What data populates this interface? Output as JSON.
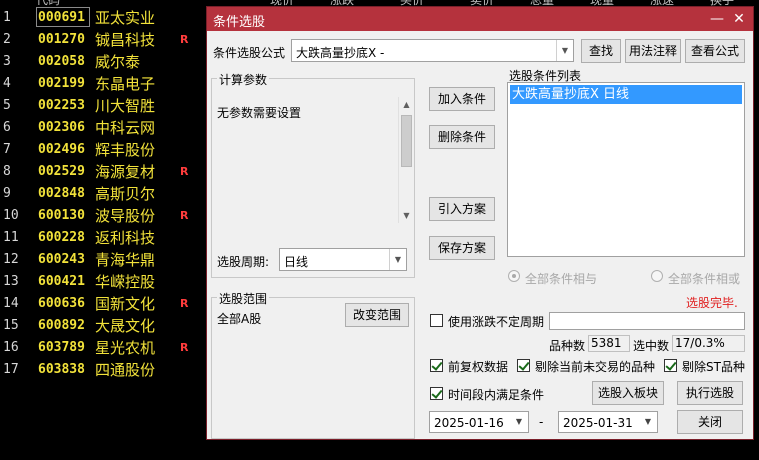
{
  "stocks": [
    {
      "idx": "1",
      "code": "000691",
      "name": "亚太实业",
      "flag": ""
    },
    {
      "idx": "2",
      "code": "001270",
      "name": "铖昌科技",
      "flag": "R"
    },
    {
      "idx": "3",
      "code": "002058",
      "name": "威尔泰",
      "flag": ""
    },
    {
      "idx": "4",
      "code": "002199",
      "name": "东晶电子",
      "flag": ""
    },
    {
      "idx": "5",
      "code": "002253",
      "name": "川大智胜",
      "flag": ""
    },
    {
      "idx": "6",
      "code": "002306",
      "name": "中科云网",
      "flag": ""
    },
    {
      "idx": "7",
      "code": "002496",
      "name": "辉丰股份",
      "flag": ""
    },
    {
      "idx": "8",
      "code": "002529",
      "name": "海源复材",
      "flag": "R"
    },
    {
      "idx": "9",
      "code": "002848",
      "name": "高斯贝尔",
      "flag": ""
    },
    {
      "idx": "10",
      "code": "600130",
      "name": "波导股份",
      "flag": "R"
    },
    {
      "idx": "11",
      "code": "600228",
      "name": "返利科技",
      "flag": ""
    },
    {
      "idx": "12",
      "code": "600243",
      "name": "青海华鼎",
      "flag": ""
    },
    {
      "idx": "13",
      "code": "600421",
      "name": "华嵘控股",
      "flag": ""
    },
    {
      "idx": "14",
      "code": "600636",
      "name": "国新文化",
      "flag": "R"
    },
    {
      "idx": "15",
      "code": "600892",
      "name": "大晟文化",
      "flag": ""
    },
    {
      "idx": "16",
      "code": "603789",
      "name": "星光农机",
      "flag": "R"
    },
    {
      "idx": "17",
      "code": "603838",
      "name": "四通股份",
      "flag": ""
    }
  ],
  "dialog": {
    "title": "条件选股",
    "formula_label": "条件选股公式",
    "formula_value": "大跌高量抄底X -",
    "find_btn": "查找",
    "usage_btn": "用法注释",
    "view_formula_btn": "查看公式",
    "params_group": "计算参数",
    "params_text": "无参数需要设置",
    "period_label": "选股周期:",
    "period_value": "日线",
    "add_cond_btn": "加入条件",
    "del_cond_btn": "删除条件",
    "import_plan_btn": "引入方案",
    "save_plan_btn": "保存方案",
    "cond_list_label": "选股条件列表",
    "cond_items": [
      "大跌高量抄底X  日线"
    ],
    "radio_and": "全部条件相与",
    "radio_or": "全部条件相或",
    "status": "选股完毕.",
    "range_group": "选股范围",
    "range_value": "全部A股",
    "change_range_btn": "改变范围",
    "use_period_label": "使用涨跌不定周期",
    "count_label": "品种数",
    "count_value": "5381",
    "selected_label": "选中数",
    "selected_value": "17/0.3%",
    "adj_label": "前复权数据",
    "exclude_untraded_label": "剔除当前未交易的品种",
    "exclude_st_label": "剔除ST品种",
    "time_range_label": "时间段内满足条件",
    "add_to_block_btn": "选股入板块",
    "run_btn": "执行选股",
    "date_from": "2025-01-16",
    "date_sep": "-",
    "date_to": "2025-01-31",
    "close_btn": "关闭"
  },
  "colors": {
    "title_bar": "#b5323d",
    "stock_code": "#f2e23a",
    "flag": "#ff3c3c",
    "status": "#e02020",
    "selection": "#3399ff"
  }
}
